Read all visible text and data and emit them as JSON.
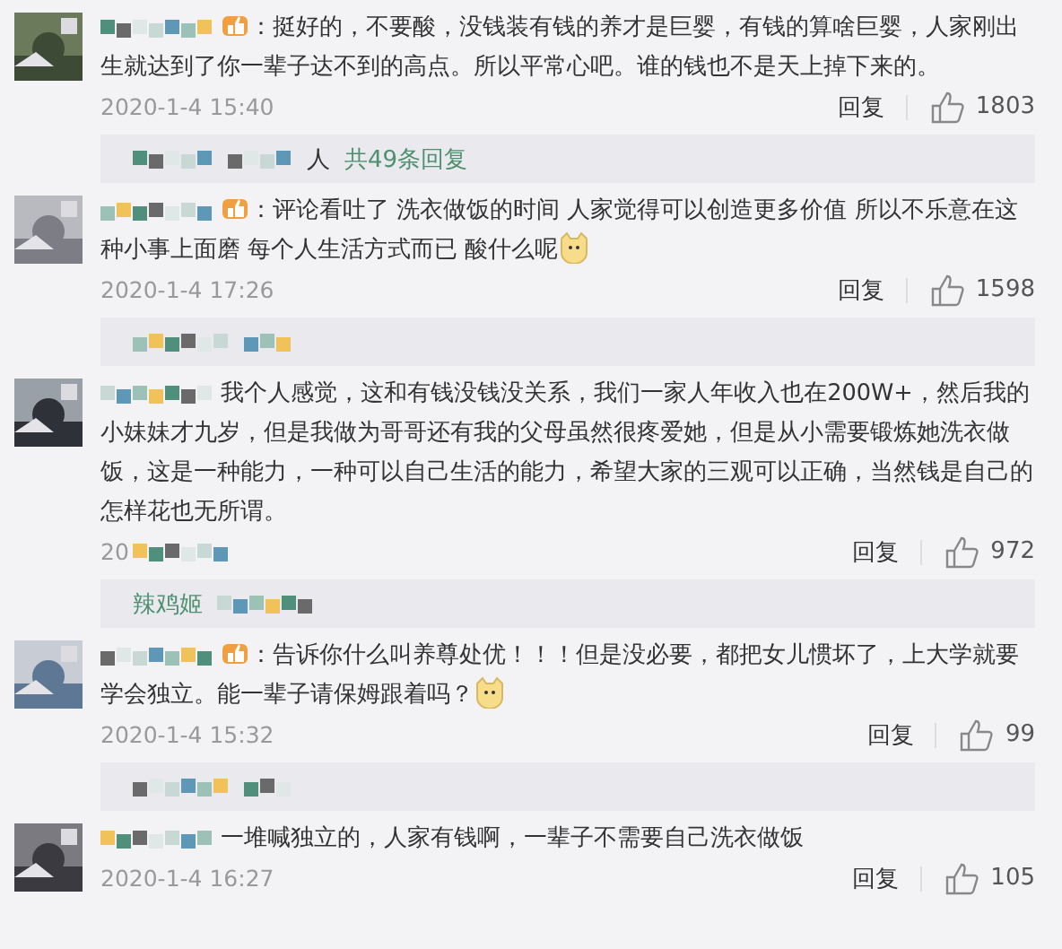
{
  "comments": [
    {
      "badge": true,
      "text": "：挺好的，不要酸，没钱装有钱的养才是巨婴，有钱的算啥巨婴，人家刚出生就达到了你一辈子达不到的高点。所以平常心吧。谁的钱也不是天上掉下来的。",
      "emoji": false,
      "time": "2020-1-4 15:40",
      "time_masked": false,
      "reply": "回复",
      "likes": "1803",
      "reply_box": {
        "kind": "summary",
        "text": "人",
        "link": "共49条回复"
      }
    },
    {
      "badge": true,
      "text": "：评论看吐了 洗衣做饭的时间 人家觉得可以创造更多价值 所以不乐意在这种小事上面磨 每个人生活方式而已 酸什么呢",
      "emoji": true,
      "time": "2020-1-4 17:26",
      "time_masked": false,
      "reply": "回复",
      "likes": "1598",
      "reply_box": {
        "kind": "masked"
      }
    },
    {
      "badge": false,
      "text": "我个人感觉，这和有钱没钱没关系，我们一家人年收入也在200W+，然后我的小妹妹才九岁，但是我做为哥哥还有我的父母虽然很疼爱她，但是从小需要锻炼她洗衣做饭，这是一种能力，一种可以自己生活的能力，希望大家的三观可以正确，当然钱是自己的怎样花也无所谓。",
      "emoji": false,
      "time": "20",
      "time_masked": true,
      "reply": "回复",
      "likes": "972",
      "reply_box": {
        "kind": "name",
        "name": "辣鸡姬"
      }
    },
    {
      "badge": true,
      "text": "：告诉你什么叫养尊处优！！！但是没必要，都把女儿惯坏了，上大学就要学会独立。能一辈子请保姆跟着吗？",
      "emoji": true,
      "time": "2020-1-4 15:32",
      "time_masked": false,
      "reply": "回复",
      "likes": "99",
      "reply_box": {
        "kind": "masked"
      }
    },
    {
      "badge": false,
      "text": "一堆喊独立的，人家有钱啊，一辈子不需要自己洗衣做饭",
      "emoji": false,
      "time": "2020-1-4 16:27",
      "time_masked": false,
      "reply": "回复",
      "likes": "105"
    }
  ]
}
